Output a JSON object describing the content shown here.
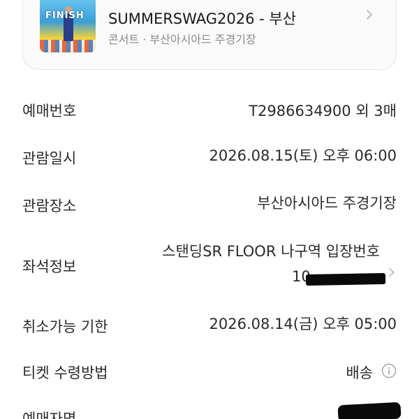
{
  "event": {
    "title_top": "",
    "title": "SUMMERSWAG2026 - 부산",
    "subtitle": "콘서트 · 부산아시아드 주경기장",
    "poster_text": "FINISH"
  },
  "details": {
    "booking_number": {
      "label": "예매번호",
      "value": "T2986634900 외 3매"
    },
    "viewing_date": {
      "label": "관람일시",
      "value": "2026.08.15(토) 오후 06:00"
    },
    "venue": {
      "label": "관람장소",
      "value": "부산아시아드 주경기장"
    },
    "seat": {
      "label": "좌석정보",
      "line1": "스탠딩SR FLOOR 나구역 입장번호",
      "line2_prefix": "10"
    },
    "cancel_deadline": {
      "label": "취소가능 기한",
      "value": "2026.08.14(금) 오후 05:00"
    },
    "ticket_method": {
      "label": "티켓 수령방법",
      "value": "배송"
    },
    "booker_name": {
      "label": "예매자명"
    }
  },
  "icons": {
    "chevron": "chevron-right-icon",
    "info": "info-icon"
  },
  "colors": {
    "text": "#2a2a2a",
    "muted": "#8a8a8e",
    "card_bg": "#fafafb",
    "card_border": "#e6e6e8",
    "chevron": "#b5b5b8"
  }
}
